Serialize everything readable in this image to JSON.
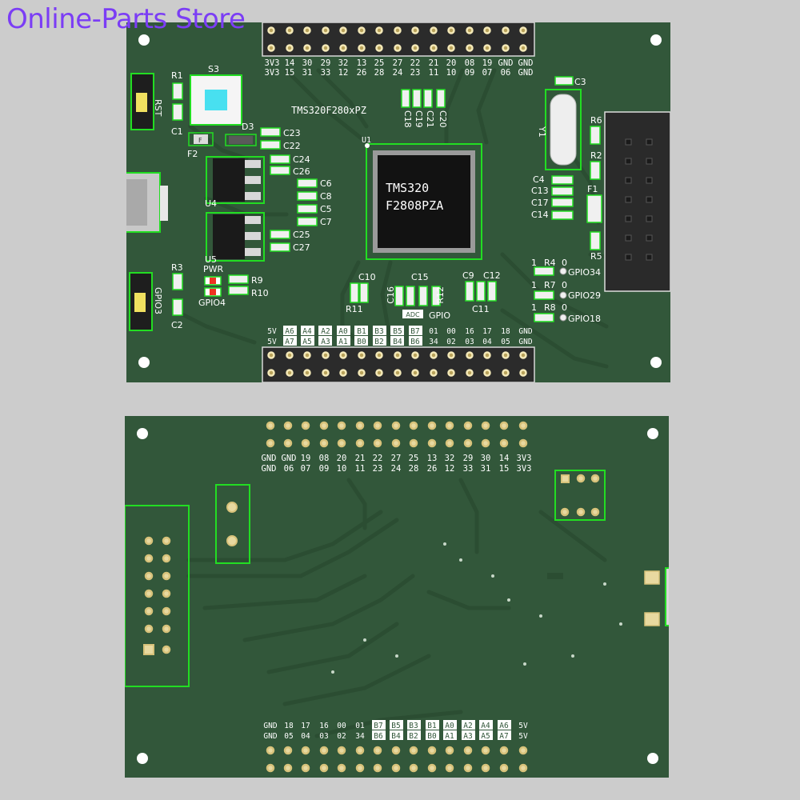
{
  "watermark": "Online-Parts Store",
  "top": {
    "board_label": "TMS320F280xPZ",
    "chip_line1": "TMS320",
    "chip_line2": "F2808PZA",
    "u1": "U1",
    "header_top_row1": [
      "3V3",
      "14",
      "30",
      "29",
      "32",
      "13",
      "25",
      "27",
      "22",
      "21",
      "20",
      "08",
      "19",
      "GND",
      "GND"
    ],
    "header_top_row2": [
      "3V3",
      "15",
      "31",
      "33",
      "12",
      "26",
      "28",
      "24",
      "23",
      "11",
      "10",
      "09",
      "07",
      "06",
      "GND"
    ],
    "header_bot_row1": [
      "5V",
      "A6",
      "A4",
      "A2",
      "A0",
      "B1",
      "B3",
      "B5",
      "B7",
      "01",
      "00",
      "16",
      "17",
      "18",
      "GND"
    ],
    "header_bot_row2": [
      "5V",
      "A7",
      "A5",
      "A3",
      "A1",
      "B0",
      "B2",
      "B4",
      "B6",
      "34",
      "02",
      "03",
      "04",
      "05",
      "GND"
    ],
    "labels": {
      "r1": "R1",
      "s3": "S3",
      "rst": "RST",
      "c1": "C1",
      "f2": "F2",
      "d3": "D3",
      "c23": "C23",
      "c22": "C22",
      "c24": "C24",
      "c26": "C26",
      "c6": "C6",
      "c8": "C8",
      "c5": "C5",
      "c7": "C7",
      "c25": "C25",
      "c27": "C27",
      "u4": "U4",
      "u5": "U5",
      "r3": "R3",
      "gpio3": "GPIO3",
      "c2": "C2",
      "pwr": "PWR",
      "gpio4": "GPIO4",
      "r9": "R9",
      "r10": "R10",
      "c10": "C10",
      "r11": "R11",
      "c15": "C15",
      "c16": "C16",
      "r12": "R12",
      "adc": "ADC",
      "gpio": "GPIO",
      "c9": "C9",
      "c12": "C12",
      "c11": "C11",
      "c18": "C18",
      "c19": "C19",
      "c21": "C21",
      "c20": "C20",
      "c3": "C3",
      "y1": "Y1",
      "c4": "C4",
      "c13": "C13",
      "c17": "C17",
      "c14": "C14",
      "r6": "R6",
      "r2": "R2",
      "f1": "F1",
      "r5": "R5",
      "r4": "R4",
      "r7": "R7",
      "r8": "R8",
      "gpio34": "GPIO34",
      "gpio29": "GPIO29",
      "gpio18": "GPIO18",
      "one": "1",
      "zero": "0"
    }
  },
  "bottom": {
    "header_top_row1": [
      "GND",
      "GND",
      "19",
      "08",
      "20",
      "21",
      "22",
      "27",
      "25",
      "13",
      "32",
      "29",
      "30",
      "14",
      "3V3"
    ],
    "header_top_row2": [
      "GND",
      "06",
      "07",
      "09",
      "10",
      "11",
      "23",
      "24",
      "28",
      "26",
      "12",
      "33",
      "31",
      "15",
      "3V3"
    ],
    "header_bot_row1": [
      "GND",
      "18",
      "17",
      "16",
      "00",
      "01",
      "B7",
      "B5",
      "B3",
      "B1",
      "A0",
      "A2",
      "A4",
      "A6",
      "5V"
    ],
    "header_bot_row2": [
      "GND",
      "05",
      "04",
      "03",
      "02",
      "34",
      "B6",
      "B4",
      "B2",
      "B0",
      "A1",
      "A3",
      "A5",
      "A7",
      "5V"
    ]
  }
}
